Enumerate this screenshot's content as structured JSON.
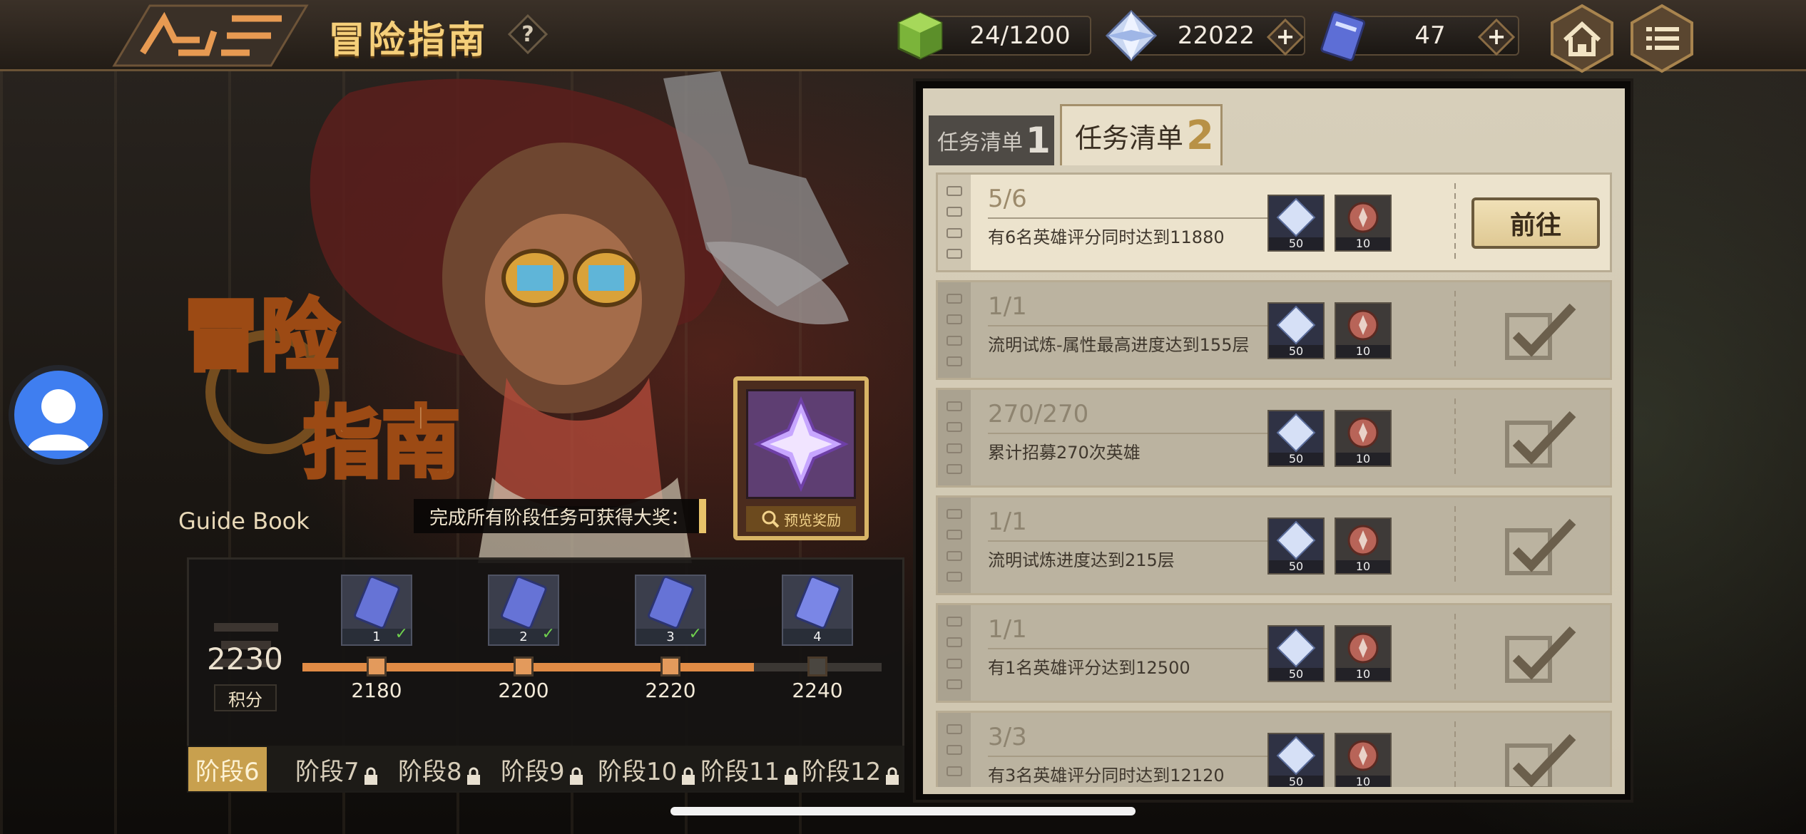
{
  "header": {
    "title": "冒险指南",
    "help_label": "?",
    "resources": {
      "stamina": "24/1200",
      "diamonds": "22022",
      "tickets": "47"
    },
    "plus_label": "+"
  },
  "hero": {
    "big_title_line1": "冒险",
    "big_title_line2": "指南",
    "subtitle": "Guide Book",
    "prize_text": "完成所有阶段任务可获得大奖：",
    "prize_card_caption": "预览奖励"
  },
  "score": {
    "value": "2230",
    "label": "积分"
  },
  "milestones": [
    {
      "reward_index": "1",
      "threshold": "2180",
      "claimed": true
    },
    {
      "reward_index": "2",
      "threshold": "2200",
      "claimed": true
    },
    {
      "reward_index": "3",
      "threshold": "2220",
      "claimed": true
    },
    {
      "reward_index": "4",
      "threshold": "2240",
      "claimed": false
    }
  ],
  "progress_fraction": 0.78,
  "stage_tabs": [
    {
      "label": "阶段6",
      "active": true,
      "locked": false
    },
    {
      "label": "阶段7",
      "active": false,
      "locked": true
    },
    {
      "label": "阶段8",
      "active": false,
      "locked": true
    },
    {
      "label": "阶段9",
      "active": false,
      "locked": true
    },
    {
      "label": "阶段10",
      "active": false,
      "locked": true
    },
    {
      "label": "阶段11",
      "active": false,
      "locked": true
    },
    {
      "label": "阶段12",
      "active": false,
      "locked": true
    }
  ],
  "task_tabs": [
    {
      "label": "任务清单",
      "number": "1",
      "active": false
    },
    {
      "label": "任务清单",
      "number": "2",
      "active": true
    }
  ],
  "tasks": [
    {
      "progress": "5/6",
      "description": "有6名英雄评分同时达到11880",
      "reward_gem_count": "50",
      "reward_token_count": "10",
      "status": "go",
      "action_label": "前往"
    },
    {
      "progress": "1/1",
      "description": "流明试炼-属性最高进度达到155层",
      "reward_gem_count": "50",
      "reward_token_count": "10",
      "status": "done"
    },
    {
      "progress": "270/270",
      "description": "累计招募270次英雄",
      "reward_gem_count": "50",
      "reward_token_count": "10",
      "status": "done"
    },
    {
      "progress": "1/1",
      "description": "流明试炼进度达到215层",
      "reward_gem_count": "50",
      "reward_token_count": "10",
      "status": "done"
    },
    {
      "progress": "1/1",
      "description": "有1名英雄评分达到12500",
      "reward_gem_count": "50",
      "reward_token_count": "10",
      "status": "done"
    },
    {
      "progress": "3/3",
      "description": "有3名英雄评分同时达到12120",
      "reward_gem_count": "50",
      "reward_token_count": "10",
      "status": "done"
    }
  ],
  "colors": {
    "accent_gold": "#f5cf7a",
    "progress_orange": "#e08b45",
    "active_tab": "#c8a04e",
    "claimed_check": "#6fd04e"
  },
  "icons": [
    "logo-icon",
    "help-icon",
    "stamina-cube-icon",
    "diamond-icon",
    "ticket-icon",
    "plus-icon",
    "home-icon",
    "menu-icon",
    "avatar-icon",
    "lock-icon",
    "check-icon",
    "magnifier-icon"
  ]
}
